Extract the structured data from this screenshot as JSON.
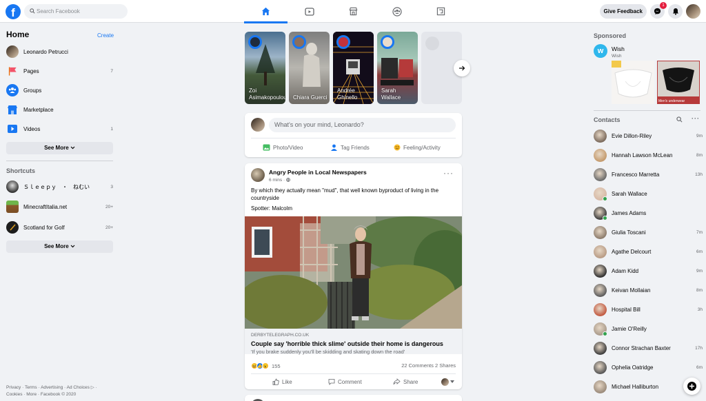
{
  "topbar": {
    "search_placeholder": "Search Facebook",
    "feedback_label": "Give Feedback",
    "messenger_badge": "1",
    "tabs": [
      "home-icon",
      "watch-icon",
      "marketplace-icon",
      "groups-icon",
      "gaming-icon"
    ]
  },
  "left": {
    "title": "Home",
    "create": "Create",
    "items": [
      {
        "label": "Leonardo Petrucci",
        "count": ""
      },
      {
        "label": "Pages",
        "count": "7"
      },
      {
        "label": "Groups",
        "count": ""
      },
      {
        "label": "Marketplace",
        "count": ""
      },
      {
        "label": "Videos",
        "count": "1"
      }
    ],
    "see_more": "See More",
    "shortcuts_title": "Shortcuts",
    "shortcuts": [
      {
        "label": "Ｓｌｅｅｐｙ　・　ねむい",
        "count": "3"
      },
      {
        "label": "MinecraftItalia.net",
        "count": "20+"
      },
      {
        "label": "Scotland for Golf",
        "count": "20+"
      }
    ],
    "see_more_2": "See More",
    "footer_line1": "Privacy · Terms · Advertising · Ad Choices ▷ ·",
    "footer_line2": "Cookies · More · Facebook © 2020"
  },
  "stories": [
    {
      "name": "Zoi Asimakopoulou"
    },
    {
      "name": "Chiara Guerci"
    },
    {
      "name": "Andrée Ghinello"
    },
    {
      "name": "Sarah Wallace"
    }
  ],
  "composer": {
    "placeholder": "What's on your mind, Leonardo?",
    "photo": "Photo/Video",
    "tag": "Tag Friends",
    "feeling": "Feeling/Activity"
  },
  "post": {
    "author": "Angry People in Local Newspapers",
    "time": "6 mins · ",
    "text": "By which they actually mean \"mud\", that well known byproduct of living in the countryside",
    "spotter": "Spotter: Malcolm",
    "link_domain": "DERBYTELEGRAPH.CO.UK",
    "link_title": "Couple say 'horrible thick slime' outside their home is dangerous",
    "link_sub": "'If you brake suddenly you'll be skidding and skating down the road'",
    "reactions_count": "155",
    "comments_shares": "22 Comments  2 Shares",
    "like": "Like",
    "comment": "Comment",
    "share": "Share"
  },
  "right": {
    "sponsored": "Sponsored",
    "ad_name": "Wish",
    "ad_sub": "Wish",
    "ad_caption": "Men's underwear",
    "contacts_title": "Contacts",
    "contacts": [
      {
        "name": "Evie Dillon-Riley",
        "time": "9m",
        "online": false
      },
      {
        "name": "Hannah Lawson McLean",
        "time": "8m",
        "online": false
      },
      {
        "name": "Francesco Marretta",
        "time": "13h",
        "online": false
      },
      {
        "name": "Sarah Wallace",
        "time": "",
        "online": true
      },
      {
        "name": "James Adams",
        "time": "",
        "online": true
      },
      {
        "name": "Giulia Toscani",
        "time": "7m",
        "online": false
      },
      {
        "name": "Agathe Delcourt",
        "time": "6m",
        "online": false
      },
      {
        "name": "Adam Kidd",
        "time": "9m",
        "online": false
      },
      {
        "name": "Keivan Mollaian",
        "time": "8m",
        "online": false
      },
      {
        "name": "Hospital Bill",
        "time": "3h",
        "online": false
      },
      {
        "name": "Jamie O'Reilly",
        "time": "",
        "online": true
      },
      {
        "name": "Connor Strachan Baxter",
        "time": "17h",
        "online": false
      },
      {
        "name": "Ophelia Oatridge",
        "time": "6m",
        "online": false
      },
      {
        "name": "Michael Halliburton",
        "time": "",
        "online": false
      }
    ]
  },
  "colors": {
    "brand": "#1877f2",
    "background": "#f0f2f5",
    "online": "#31a24c"
  }
}
